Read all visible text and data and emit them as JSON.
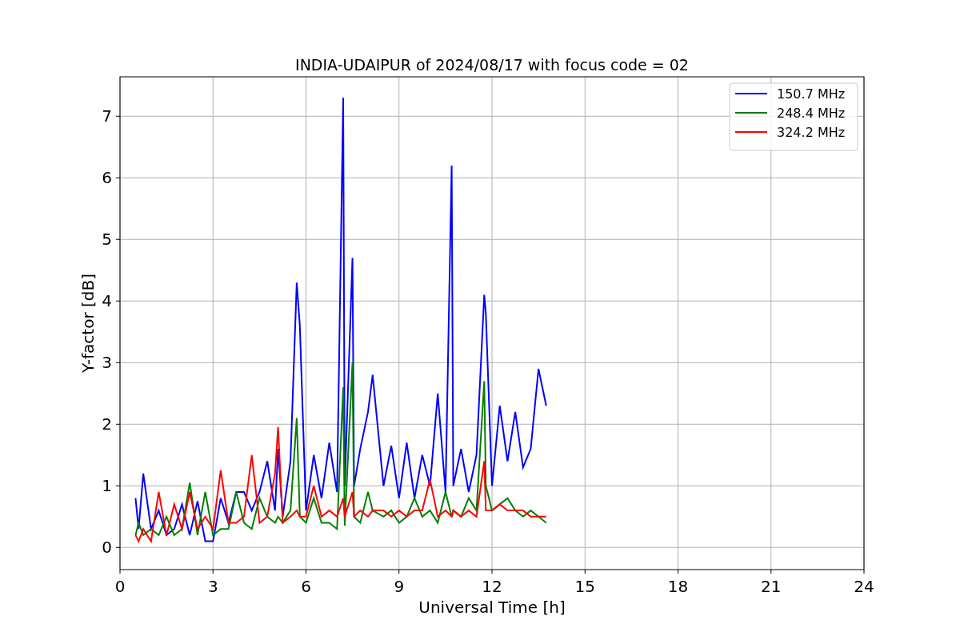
{
  "figure": {
    "chart_data": {
      "type": "line",
      "title": "INDIA-UDAIPUR of 2024/08/17 with focus code = 02",
      "xlabel": "Universal Time [h]",
      "ylabel": "Y-factor [dB]",
      "x": [
        0.5,
        0.6,
        0.75,
        1,
        1.25,
        1.5,
        1.75,
        2,
        2.25,
        2.5,
        2.75,
        3,
        3.25,
        3.5,
        3.75,
        4,
        4.25,
        4.5,
        4.75,
        5,
        5.1,
        5.25,
        5.5,
        5.7,
        5.8,
        6,
        6.25,
        6.5,
        6.75,
        7,
        7.2,
        7.25,
        7.5,
        7.55,
        7.75,
        8,
        8.15,
        8.5,
        8.75,
        9,
        9.25,
        9.5,
        9.75,
        10,
        10.25,
        10.5,
        10.7,
        10.75,
        11,
        11.25,
        11.5,
        11.75,
        11.8,
        12,
        12.25,
        12.5,
        12.75,
        13,
        13.25,
        13.5,
        13.75
      ],
      "series": [
        {
          "name": "150.7 MHz",
          "color": "#0000ff",
          "values": [
            0.8,
            0.3,
            1.2,
            0.3,
            0.6,
            0.2,
            0.3,
            0.7,
            0.2,
            0.75,
            0.1,
            0.1,
            0.8,
            0.4,
            0.9,
            0.9,
            0.6,
            0.9,
            1.4,
            0.6,
            1.6,
            0.5,
            1.4,
            4.3,
            3.6,
            0.6,
            1.5,
            0.8,
            1.7,
            0.9,
            7.3,
            1.0,
            4.7,
            1.0,
            1.6,
            2.2,
            2.8,
            1.0,
            1.65,
            0.8,
            1.7,
            0.8,
            1.5,
            1.0,
            2.5,
            0.9,
            6.2,
            1.0,
            1.6,
            0.9,
            1.5,
            4.1,
            3.8,
            1.0,
            2.3,
            1.4,
            2.2,
            1.3,
            1.6,
            2.9,
            2.3
          ]
        },
        {
          "name": "248.4 MHz",
          "color": "#008000",
          "values": [
            0.2,
            0.4,
            0.2,
            0.3,
            0.2,
            0.5,
            0.2,
            0.3,
            1.05,
            0.2,
            0.9,
            0.2,
            0.3,
            0.3,
            0.9,
            0.4,
            0.3,
            0.8,
            0.5,
            0.4,
            0.5,
            0.4,
            0.6,
            2.1,
            0.5,
            0.4,
            0.8,
            0.4,
            0.4,
            0.3,
            2.6,
            0.35,
            3.0,
            0.5,
            0.4,
            0.9,
            0.6,
            0.5,
            0.6,
            0.4,
            0.5,
            0.8,
            0.5,
            0.6,
            0.4,
            0.9,
            0.5,
            0.6,
            0.5,
            0.8,
            0.6,
            2.7,
            1.0,
            0.6,
            0.7,
            0.8,
            0.6,
            0.5,
            0.6,
            0.5,
            0.4
          ]
        },
        {
          "name": "324.2 MHz",
          "color": "#ff0000",
          "values": [
            0.2,
            0.1,
            0.3,
            0.1,
            0.9,
            0.2,
            0.7,
            0.3,
            0.9,
            0.3,
            0.5,
            0.3,
            1.25,
            0.4,
            0.4,
            0.5,
            1.5,
            0.4,
            0.5,
            1.2,
            1.95,
            0.4,
            0.5,
            0.6,
            0.5,
            0.5,
            1.0,
            0.5,
            0.6,
            0.5,
            0.8,
            0.5,
            0.9,
            0.5,
            0.6,
            0.5,
            0.6,
            0.6,
            0.5,
            0.6,
            0.5,
            0.6,
            0.6,
            1.1,
            0.5,
            0.6,
            0.5,
            0.6,
            0.5,
            0.6,
            0.5,
            1.4,
            0.6,
            0.6,
            0.7,
            0.6,
            0.6,
            0.6,
            0.5,
            0.5,
            0.5
          ]
        }
      ],
      "grid": true,
      "legend": true,
      "xlim": [
        0,
        24
      ],
      "ylim": [
        -0.36,
        7.64
      ],
      "xticks": [
        0,
        3,
        6,
        9,
        12,
        15,
        18,
        21,
        24
      ],
      "yticks": [
        0,
        1,
        2,
        3,
        4,
        5,
        6,
        7
      ]
    }
  }
}
